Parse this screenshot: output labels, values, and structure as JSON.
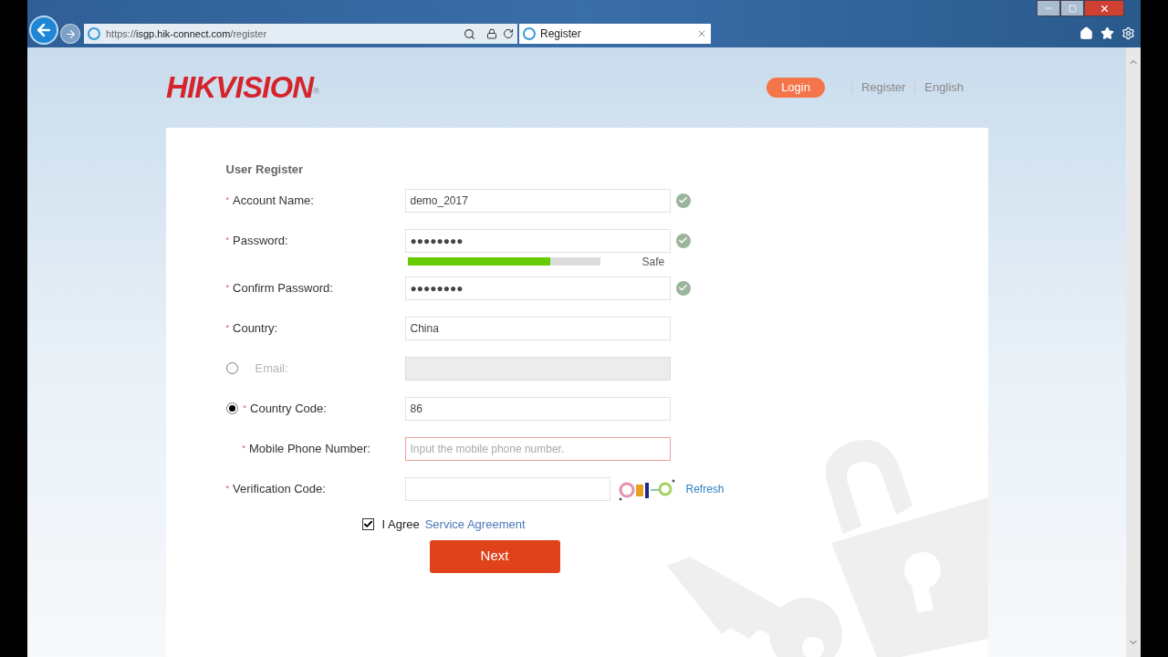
{
  "browser": {
    "address": {
      "scheme": "https://",
      "host": "isgp.hik-connect.com",
      "path": "/register"
    },
    "tab": {
      "title": "Register"
    }
  },
  "header": {
    "logo": "HIKVISION",
    "logo_mark": "®",
    "nav": [
      {
        "label": "Login",
        "selected": true
      },
      {
        "label": "Register",
        "selected": false
      },
      {
        "label": "English",
        "selected": false
      }
    ]
  },
  "form": {
    "title": "User Register",
    "rows": [
      {
        "kind": "input",
        "label": "Account Name:",
        "required_mark": "*",
        "value": "demo_2017",
        "valid": true
      },
      {
        "kind": "input",
        "label": "Password:",
        "required_mark": "*",
        "value": "●●●●●●●●",
        "valid": true
      },
      {
        "kind": "strength",
        "level": 0.74,
        "reading": "Safe"
      },
      {
        "kind": "input",
        "label": "Confirm Password:",
        "required_mark": "*",
        "value": "●●●●●●●●",
        "valid": true
      },
      {
        "kind": "input",
        "label": "Country:",
        "required_mark": "*",
        "value": "China",
        "valid": false
      },
      {
        "kind": "input",
        "label": "Email:",
        "disabled": true,
        "radio": {
          "selected": false
        },
        "valid": false
      },
      {
        "kind": "input",
        "label": "Country Code:",
        "required_mark": "*",
        "value": "86",
        "radio": {
          "selected": true
        },
        "valid": false
      },
      {
        "kind": "input",
        "label": "Mobile Phone Number:",
        "required_mark": "*",
        "placeholder": "Input the mobile phone number.",
        "indented": true,
        "error": true,
        "valid": false
      },
      {
        "kind": "captcha",
        "label": "Verification Code:",
        "required_mark": "*",
        "link": "Refresh"
      }
    ],
    "agreement": {
      "checked": true,
      "label": "I Agree",
      "link": "Service Agreement"
    },
    "submit": "Next"
  }
}
